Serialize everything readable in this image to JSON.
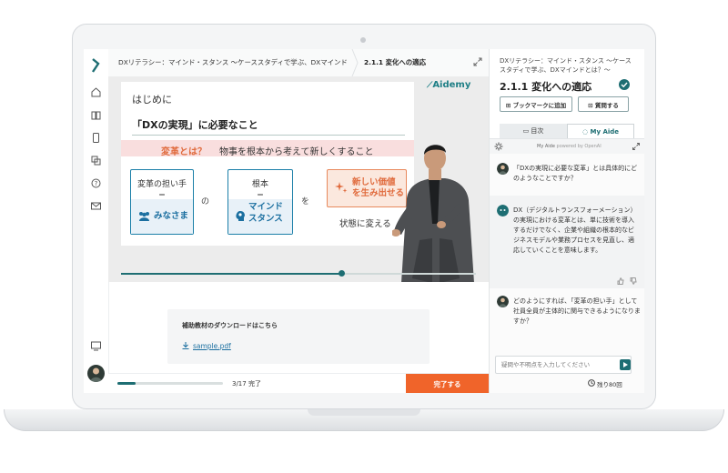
{
  "breadcrumb": {
    "course": "DXリテラシー：マインド・スタンス 〜ケーススタディで学ぶ、DXマインドとは？〜",
    "current": "2.1.1 変化への適応"
  },
  "slide": {
    "heading": "はじめに",
    "subheading": "「DXの実現」に必要なこと",
    "band_key": "変革とは？",
    "band_text": "物事を根本から考えて新しくすること",
    "box1_top": "変革の担い手",
    "box1_eq": "＝",
    "box1_label": "みなさま",
    "conj1": "の",
    "box2_top": "根本",
    "box2_eq": "＝",
    "box2_label_l1": "マインド",
    "box2_label_l2": "スタンス",
    "conj2": "を",
    "box3_l1": "新しい価値",
    "box3_l2": "を生み出せる",
    "box3_bottom": "状態に変える",
    "brand": "Aidemy"
  },
  "video": {
    "progress": 0.62
  },
  "materials": {
    "title": "補助教材のダウンロードはこちら",
    "file": "sample.pdf"
  },
  "lesson_progress": {
    "done": 3,
    "total": 17,
    "text": "3/17 完了",
    "complete_label": "完了する"
  },
  "panel": {
    "crumb": "DXリテラシー：マインド・スタンス 〜ケーススタディで学ぶ、DXマインドとは？〜",
    "title": "2.1.1 変化への適応",
    "bookmark_label": "ブックマークに追加",
    "question_label": "質問する",
    "tab_toc": "目次",
    "tab_aide": "My Aide",
    "chat_title": "My Aide",
    "chat_powered": "powered by OpenAI",
    "messages": [
      {
        "role": "user",
        "text": "「DXの実現に必要な変革」とは具体的にどのようなことですか？"
      },
      {
        "role": "ai",
        "text": "DX（デジタルトランスフォーメーション）の実現における変革とは、単に技術を導入するだけでなく、企業や組織の根本的なビジネスモデルや業務プロセスを見直し、適応していくことを意味します。"
      },
      {
        "role": "user",
        "text": "どのようにすれば、「変革の担い手」として社員全員が主体的に関与できるようになりますか？"
      }
    ],
    "input_placeholder": "疑問や不明点を入力してください",
    "remaining": "残り80回"
  },
  "colors": {
    "accent": "#1e6e73",
    "cta": "#f0642a",
    "slide_blue": "#1b7fa8"
  }
}
